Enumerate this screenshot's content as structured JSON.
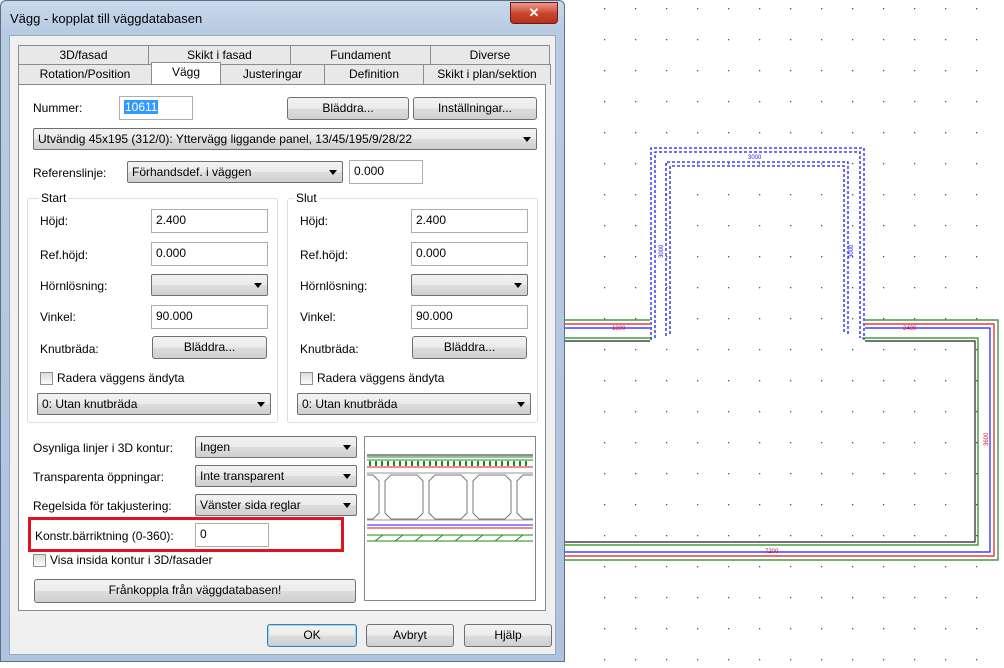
{
  "dialog": {
    "title": "Vägg - kopplat till väggdatabasen",
    "close_glyph": "✕",
    "tabs_row1": [
      "3D/fasad",
      "Skikt i fasad",
      "Fundament",
      "Diverse"
    ],
    "tabs_row2": [
      "Rotation/Position",
      "Vägg",
      "Justeringar",
      "Definition",
      "Skikt i plan/sektion"
    ],
    "active_tab": "Vägg",
    "nummer": {
      "label": "Nummer:",
      "value": "10611"
    },
    "browse_button": "Bläddra...",
    "settings_button": "Inställningar...",
    "wall_type": "Utvändig 45x195 (312/0): Yttervägg liggande panel, 13/45/195/9/28/22",
    "referenslinje": {
      "label": "Referenslinje:",
      "value": "Förhandsdef. i väggen",
      "offset": "0.000"
    },
    "start": {
      "title": "Start",
      "hojd_label": "Höjd:",
      "hojd": "2.400",
      "refhojd_label": "Ref.höjd:",
      "refhojd": "0.000",
      "hornlosning_label": "Hörnlösning:",
      "hornlosning": "",
      "vinkel_label": "Vinkel:",
      "vinkel": "90.000",
      "knutbrada_label": "Knutbräda:",
      "knutbrada_button": "Bläddra...",
      "radera_label": "Radera väggens ändyta",
      "knut_select": "0: Utan knutbräda"
    },
    "slut": {
      "title": "Slut",
      "hojd_label": "Höjd:",
      "hojd": "2.400",
      "refhojd_label": "Ref.höjd:",
      "refhojd": "0.000",
      "hornlosning_label": "Hörnlösning:",
      "hornlosning": "",
      "vinkel_label": "Vinkel:",
      "vinkel": "90.000",
      "knutbrada_label": "Knutbräda:",
      "knutbrada_button": "Bläddra...",
      "radera_label": "Radera väggens ändyta",
      "knut_select": "0: Utan knutbräda"
    },
    "osynliga": {
      "label": "Osynliga linjer i 3D kontur:",
      "value": "Ingen"
    },
    "transparenta": {
      "label": "Transparenta öppningar:",
      "value": "Inte transparent"
    },
    "regelsida": {
      "label": "Regelsida för takjustering:",
      "value": "Vänster sida reglar"
    },
    "barriktning": {
      "label": "Konstr.bärriktning (0-360):",
      "value": "0"
    },
    "visa_insida": "Visa insida kontur i 3D/fasader",
    "frankoppla_button": "Frånkoppla från väggdatabasen!",
    "ok_button": "OK",
    "cancel_button": "Avbryt",
    "help_button": "Hjälp"
  },
  "canvas": {
    "dims": {
      "top": "3000",
      "left_vert": "3000",
      "right_vert": "3000",
      "left_horiz": "1800",
      "right_horiz": "2400",
      "right_side": "3600",
      "bottom": "7200"
    },
    "colors": {
      "blue": "#1a1aff",
      "red": "#e0141e",
      "green": "#1a8a1a",
      "dark": "#222222"
    }
  }
}
